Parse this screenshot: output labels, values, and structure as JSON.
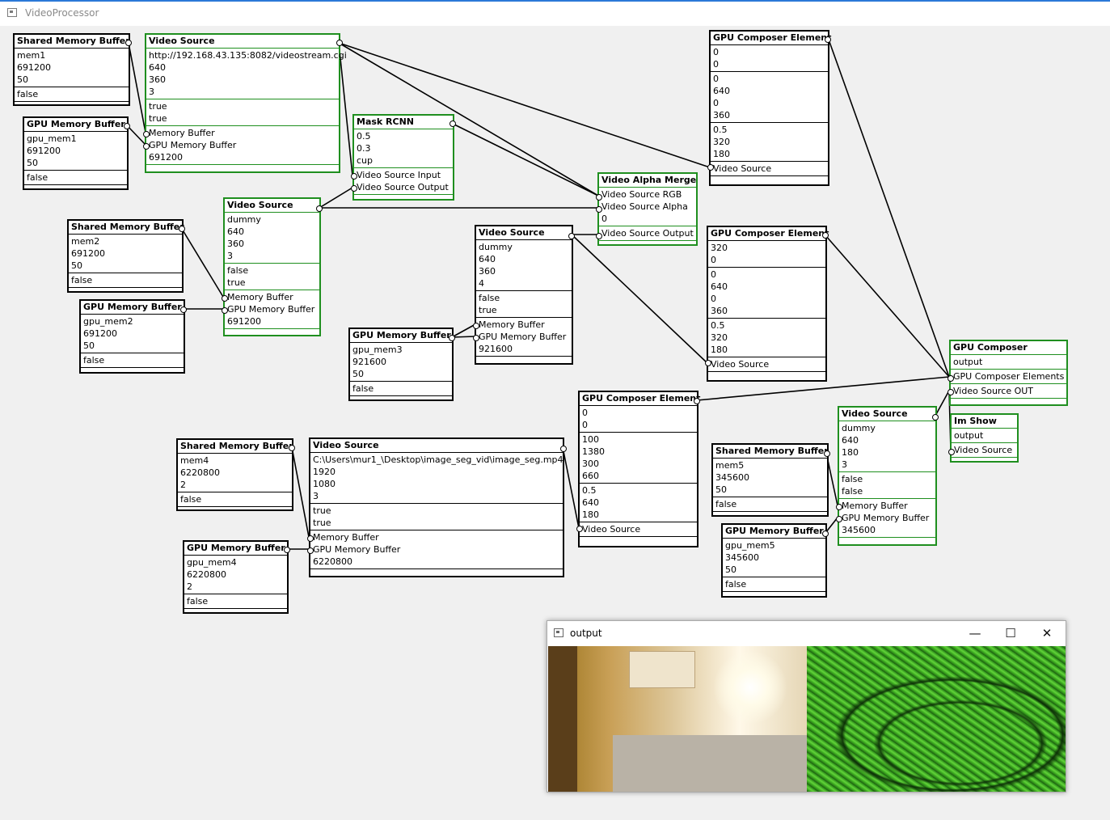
{
  "app": {
    "title": "VideoProcessor"
  },
  "nodes": {
    "shm1": {
      "title": "Shared Memory Buffer",
      "name": "mem1",
      "size": "691200",
      "count": "50",
      "flag": "false"
    },
    "gpu1": {
      "title": "GPU Memory Buffer",
      "name": "gpu_mem1",
      "size": "691200",
      "count": "50",
      "flag": "false"
    },
    "vs1": {
      "title": "Video Source",
      "src": "http://192.168.43.135:8082/videostream.cgi",
      "w": "640",
      "h": "360",
      "ch": "3",
      "b1": "true",
      "b2": "true",
      "p1": "Memory Buffer",
      "p2": "GPU Memory Buffer",
      "val": "691200"
    },
    "rcnn": {
      "title": "Mask RCNN",
      "a": "0.5",
      "b": "0.3",
      "c": "cup",
      "p1": "Video Source Input",
      "p2": "Video Source Output"
    },
    "shm2": {
      "title": "Shared Memory Buffer",
      "name": "mem2",
      "size": "691200",
      "count": "50",
      "flag": "false"
    },
    "gpu2": {
      "title": "GPU Memory Buffer",
      "name": "gpu_mem2",
      "size": "691200",
      "count": "50",
      "flag": "false"
    },
    "vs2": {
      "title": "Video Source",
      "src": "dummy",
      "w": "640",
      "h": "360",
      "ch": "3",
      "b1": "false",
      "b2": "true",
      "p1": "Memory Buffer",
      "p2": "GPU Memory Buffer",
      "val": "691200"
    },
    "alpha": {
      "title": "Video Alpha Merge",
      "p1": "Video Source RGB",
      "p2": "Video Source Alpha",
      "v": "0",
      "p3": "Video Source Output"
    },
    "vs3": {
      "title": "Video Source",
      "src": "dummy",
      "w": "640",
      "h": "360",
      "ch": "4",
      "b1": "false",
      "b2": "true",
      "p1": "Memory Buffer",
      "p2": "GPU Memory Buffer",
      "val": "921600"
    },
    "gpu3": {
      "title": "GPU Memory Buffer",
      "name": "gpu_mem3",
      "size": "921600",
      "count": "50",
      "flag": "false"
    },
    "gce1": {
      "title": "GPU Composer Element",
      "a": "0",
      "b": "0",
      "c": "0",
      "d": "640",
      "e": "0",
      "f": "360",
      "g": "0.5",
      "h": "320",
      "i": "180",
      "p": "Video Source"
    },
    "gce2": {
      "title": "GPU Composer Element",
      "a": "320",
      "b": "0",
      "c": "0",
      "d": "640",
      "e": "0",
      "f": "360",
      "g": "0.5",
      "h": "320",
      "i": "180",
      "p": "Video Source"
    },
    "gce3": {
      "title": "GPU Composer Element",
      "a": "0",
      "b": "0",
      "c": "100",
      "d": "1380",
      "e": "300",
      "f": "660",
      "g": "0.5",
      "h": "640",
      "i": "180",
      "p": "Video Source"
    },
    "composer": {
      "title": "GPU Composer",
      "out": "output",
      "p1": "GPU Composer Elements",
      "p2": "Video Source OUT"
    },
    "imshow": {
      "title": "Im Show",
      "out": "output",
      "p1": "Video Source"
    },
    "shm4": {
      "title": "Shared Memory Buffer",
      "name": "mem4",
      "size": "6220800",
      "count": "2",
      "flag": "false"
    },
    "gpu4": {
      "title": "GPU Memory Buffer",
      "name": "gpu_mem4",
      "size": "6220800",
      "count": "2",
      "flag": "false"
    },
    "vs4": {
      "title": "Video Source",
      "src": "C:\\Users\\mur1_\\Desktop\\image_seg_vid\\image_seg.mp4",
      "w": "1920",
      "h": "1080",
      "ch": "3",
      "b1": "true",
      "b2": "true",
      "p1": "Memory Buffer",
      "p2": "GPU Memory Buffer",
      "val": "6220800"
    },
    "shm5": {
      "title": "Shared Memory Buffer",
      "name": "mem5",
      "size": "345600",
      "count": "50",
      "flag": "false"
    },
    "gpu5": {
      "title": "GPU Memory Buffer",
      "name": "gpu_mem5",
      "size": "345600",
      "count": "50",
      "flag": "false"
    },
    "vs5": {
      "title": "Video Source",
      "src": "dummy",
      "w": "640",
      "h": "180",
      "ch": "3",
      "b1": "false",
      "b2": "false",
      "p1": "Memory Buffer",
      "p2": "GPU Memory Buffer",
      "val": "345600"
    }
  },
  "output_window": {
    "title": "output",
    "minimize": "—",
    "maximize": "☐",
    "close": "✕"
  },
  "colors": {
    "active_border": "#1f8f1f",
    "inactive_border": "#000000",
    "titlebar_accent": "#2b79d8"
  }
}
